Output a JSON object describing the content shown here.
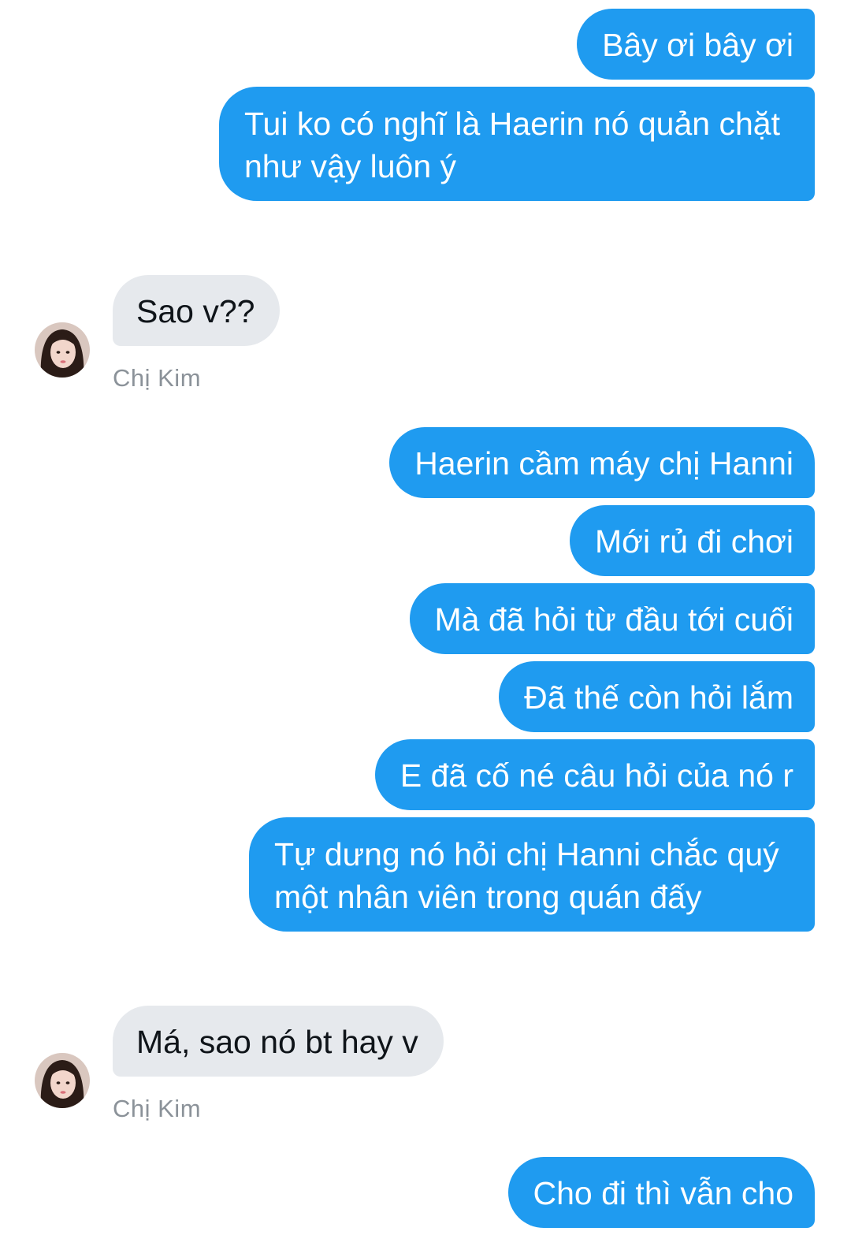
{
  "contact": {
    "name": "Chị Kim"
  },
  "colors": {
    "outgoing_bubble": "#1f9bf0",
    "incoming_bubble": "#e6e9ed",
    "sender_name": "#8b9299"
  },
  "messages": [
    {
      "from": "me",
      "text": "Bây ơi bây ơi"
    },
    {
      "from": "me",
      "text": "Tui ko có nghĩ là Haerin nó quản chặt như vậy luôn ý"
    },
    {
      "from": "them",
      "text": "Sao v??"
    },
    {
      "from": "me",
      "text": "Haerin cầm máy chị Hanni"
    },
    {
      "from": "me",
      "text": "Mới rủ đi chơi"
    },
    {
      "from": "me",
      "text": "Mà đã hỏi từ đầu tới cuối"
    },
    {
      "from": "me",
      "text": "Đã thế còn hỏi lắm"
    },
    {
      "from": "me",
      "text": "E đã cố né câu hỏi của nó r"
    },
    {
      "from": "me",
      "text": "Tự dưng nó hỏi chị Hanni chắc quý một nhân viên trong quán đấy"
    },
    {
      "from": "them",
      "text": "Má, sao nó bt hay v"
    },
    {
      "from": "me",
      "text": "Cho đi thì vẫn cho"
    }
  ]
}
